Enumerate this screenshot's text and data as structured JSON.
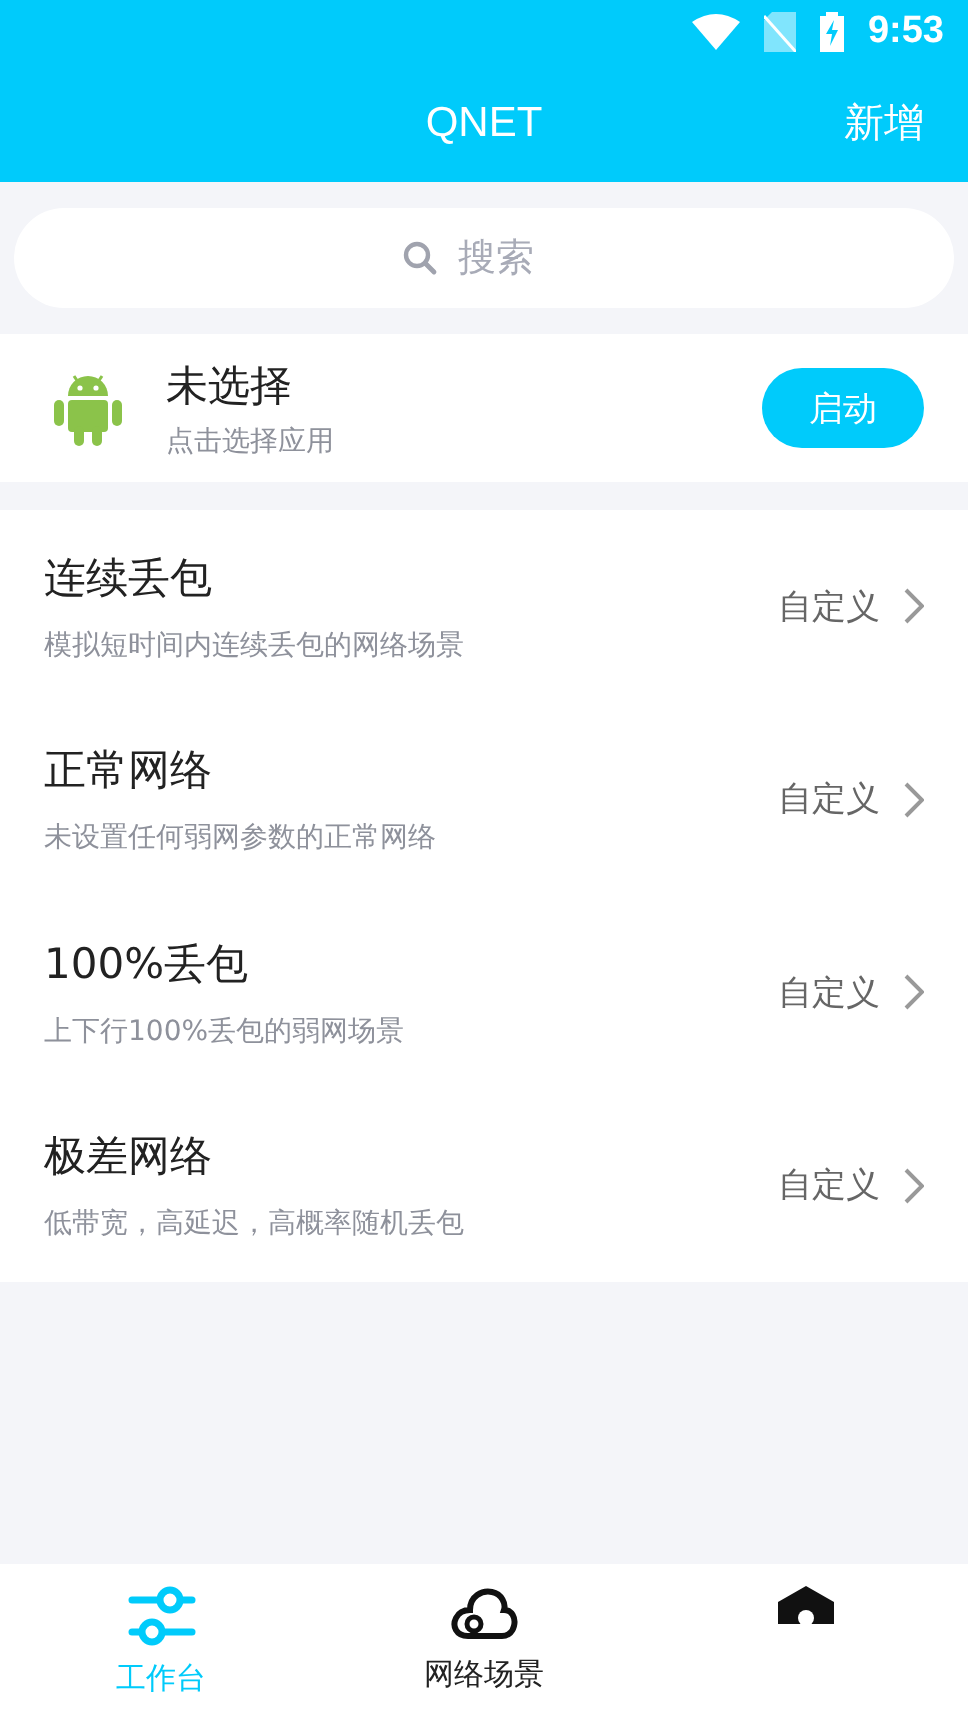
{
  "status_bar": {
    "time": "9:53"
  },
  "header": {
    "title": "QNET",
    "action": "新增"
  },
  "search": {
    "placeholder": "搜索"
  },
  "app": {
    "name": "未选择",
    "hint": "点击选择应用",
    "button": "启动"
  },
  "scenes": [
    {
      "name": "连续丢包",
      "description": "模拟短时间内连续丢包的网络场景",
      "action": "自定义"
    },
    {
      "name": "正常网络",
      "description": "未设置任何弱网参数的正常网络",
      "action": "自定义"
    },
    {
      "name": "100%丢包",
      "description": "上下行100%丢包的弱网场景",
      "action": "自定义"
    },
    {
      "name": "极差网络",
      "description": "低带宽，高延迟，高概率随机丢包",
      "action": "自定义"
    }
  ],
  "tabs": [
    {
      "kind": "sliders",
      "label": "工作台",
      "selected": true
    },
    {
      "kind": "cloud",
      "label": "网络场景",
      "selected": false
    },
    {
      "kind": "home",
      "selected": false
    }
  ]
}
